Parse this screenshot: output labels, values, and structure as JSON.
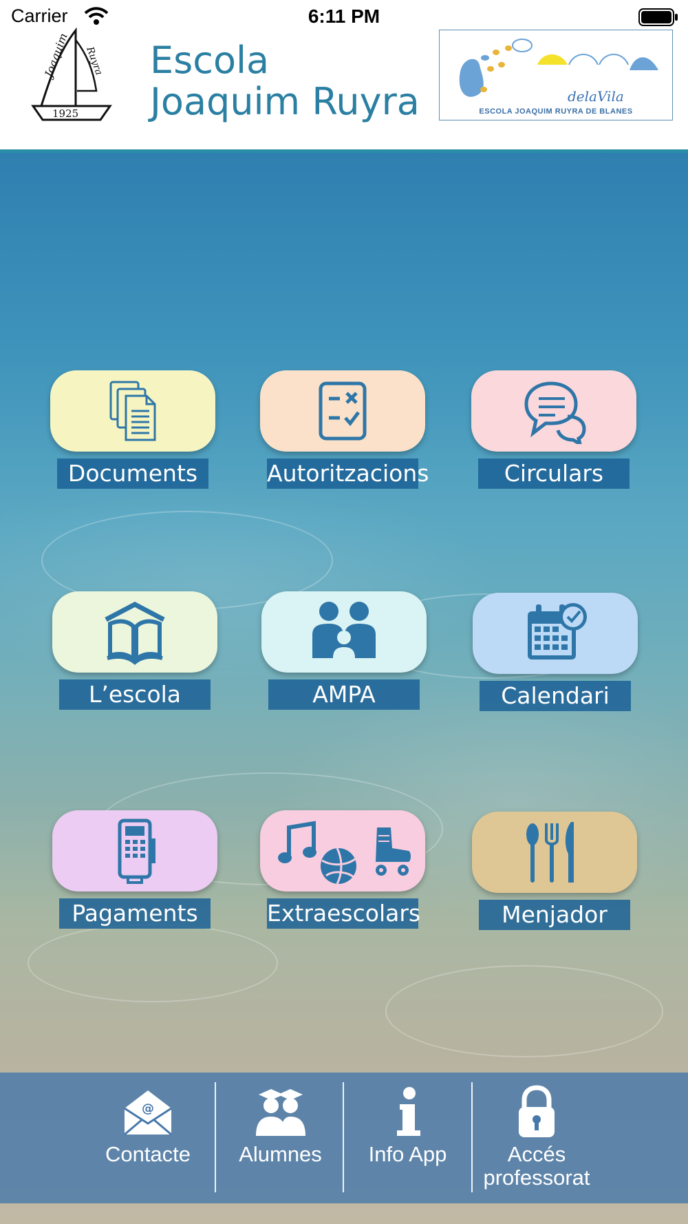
{
  "status_bar": {
    "carrier": "Carrier",
    "time": "6:11 PM"
  },
  "header": {
    "title_line1": "Escola",
    "title_line2": "Joaquim Ruyra",
    "left_logo": {
      "year": "1925",
      "script": "Joaquim Ruyra"
    },
    "right_logo": {
      "script": "delaVila",
      "caption": "ESCOLA JOAQUIM RUYRA DE BLANES"
    }
  },
  "tiles": [
    {
      "label": "Documents",
      "icon": "documents-icon",
      "color": "#f6f5c2"
    },
    {
      "label": "Autoritzacions",
      "icon": "checklist-icon",
      "color": "#fbe1c9"
    },
    {
      "label": "Circulars",
      "icon": "chat-bubbles-icon",
      "color": "#fbd8db"
    },
    {
      "label": "L’escola",
      "icon": "school-book-icon",
      "color": "#ecf6dc"
    },
    {
      "label": "AMPA",
      "icon": "family-icon",
      "color": "#daf4f5"
    },
    {
      "label": "Calendari",
      "icon": "calendar-icon",
      "color": "#bcd9f6"
    },
    {
      "label": "Pagaments",
      "icon": "payment-terminal-icon",
      "color": "#ecccf2"
    },
    {
      "label": "Extraescolars",
      "icon": "music-ball-skate-icon",
      "color": "#f9cde0"
    },
    {
      "label": "Menjador",
      "icon": "cutlery-icon",
      "color": "#dfc795"
    }
  ],
  "bottom_bar": [
    {
      "label": "Contacte",
      "icon": "email-icon"
    },
    {
      "label": "Alumnes",
      "icon": "students-icon"
    },
    {
      "label": "Info App",
      "icon": "info-icon"
    },
    {
      "label_line1": "Accés",
      "label_line2": "professorat",
      "icon": "lock-icon"
    }
  ],
  "colors": {
    "accent": "#2a7fa2",
    "icon": "#2e76a8",
    "label_bg": "#1c6296"
  }
}
